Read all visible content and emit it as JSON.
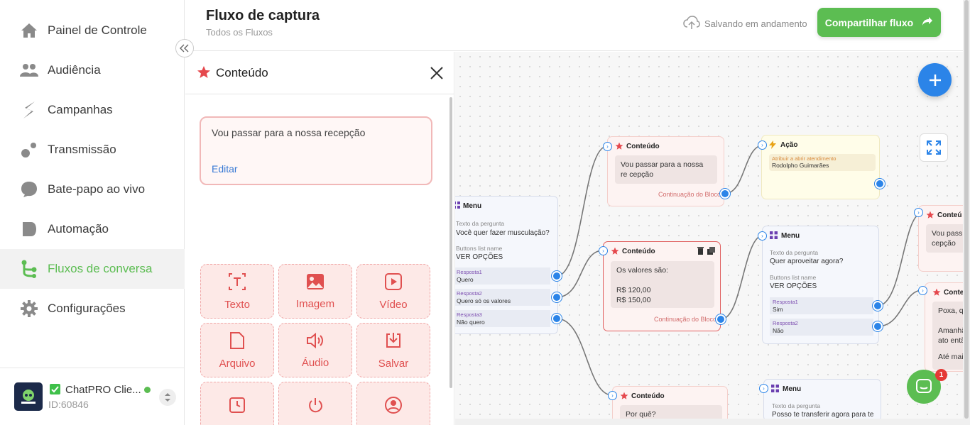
{
  "sidebar": {
    "items": [
      {
        "label": "Painel de Controle",
        "icon": "home-icon"
      },
      {
        "label": "Audiência",
        "icon": "people-icon"
      },
      {
        "label": "Campanhas",
        "icon": "campaign-icon"
      },
      {
        "label": "Transmissão",
        "icon": "broadcast-icon"
      },
      {
        "label": "Bate-papo ao vivo",
        "icon": "chat-bubble-icon"
      },
      {
        "label": "Automação",
        "icon": "automation-icon"
      },
      {
        "label": "Fluxos de conversa",
        "icon": "flow-icon"
      },
      {
        "label": "Configurações",
        "icon": "gear-icon"
      }
    ],
    "active_index": 6,
    "account": {
      "name": "ChatPRO Clie...",
      "id": "ID:60846"
    }
  },
  "header": {
    "title": "Fluxo de captura",
    "breadcrumb": "Todos os Fluxos",
    "save_status": "Salvando em andamento",
    "share_label": "Compartilhar fluxo"
  },
  "panel": {
    "title": "Conteúdo",
    "message": "Vou passar para a nossa recepção",
    "edit_label": "Editar",
    "tiles": [
      {
        "label": "Texto",
        "icon": "text-icon"
      },
      {
        "label": "Imagem",
        "icon": "image-icon"
      },
      {
        "label": "Vídeo",
        "icon": "video-icon"
      },
      {
        "label": "Arquivo",
        "icon": "file-icon"
      },
      {
        "label": "Áudio",
        "icon": "audio-icon"
      },
      {
        "label": "Salvar",
        "icon": "save-icon"
      },
      {
        "label": "",
        "icon": "clock-icon"
      },
      {
        "label": "",
        "icon": "power-icon"
      },
      {
        "label": "",
        "icon": "contact-icon"
      }
    ]
  },
  "canvas": {
    "menu1": {
      "title": "Menu",
      "q_label": "Texto da pergunta",
      "q_value": "Você quer fazer musculação?",
      "btn_label": "Buttons list name",
      "btn_value": "VER OPÇÕES",
      "options": [
        {
          "r": "Resposta1",
          "v": "Quero"
        },
        {
          "r": "Resposta2",
          "v": "Quero só os valores"
        },
        {
          "r": "Resposta3",
          "v": "Não quero"
        }
      ]
    },
    "content1": {
      "title": "Conteúdo",
      "text": "Vou passar para a nossa re cepção",
      "cont": "Continuação do Bloco"
    },
    "action1": {
      "title": "Ação",
      "label": "Atribuir a abrir atendimento",
      "value": "Rodolpho Guimarães"
    },
    "content2": {
      "title": "Conteúdo",
      "line1": "Os valores são:",
      "line2": "R$ 120,00",
      "line3": "R$ 150,00",
      "cont": "Continuação do Bloco"
    },
    "menu2": {
      "title": "Menu",
      "q_label": "Texto da pergunta",
      "q_value": "Quer aproveitar agora?",
      "btn_label": "Buttons list name",
      "btn_value": "VER OPÇÕES",
      "options": [
        {
          "r": "Resposta1",
          "v": "Sim"
        },
        {
          "r": "Resposta2",
          "v": "Não"
        }
      ]
    },
    "content3": {
      "title": "Conteú",
      "text": "Vou pass cepção"
    },
    "content4": {
      "title": "Conte",
      "l1": "Poxa, q",
      "l2": "Amanhã",
      "l3": "ato entã",
      "l4": "Até mai"
    },
    "content5": {
      "title": "Conteúdo",
      "text": "Por quê?"
    },
    "menu3": {
      "title": "Menu",
      "q_label": "Texto da pergunta",
      "q_value": "Posso te transferir agora para te"
    },
    "chat_badge": "1"
  }
}
